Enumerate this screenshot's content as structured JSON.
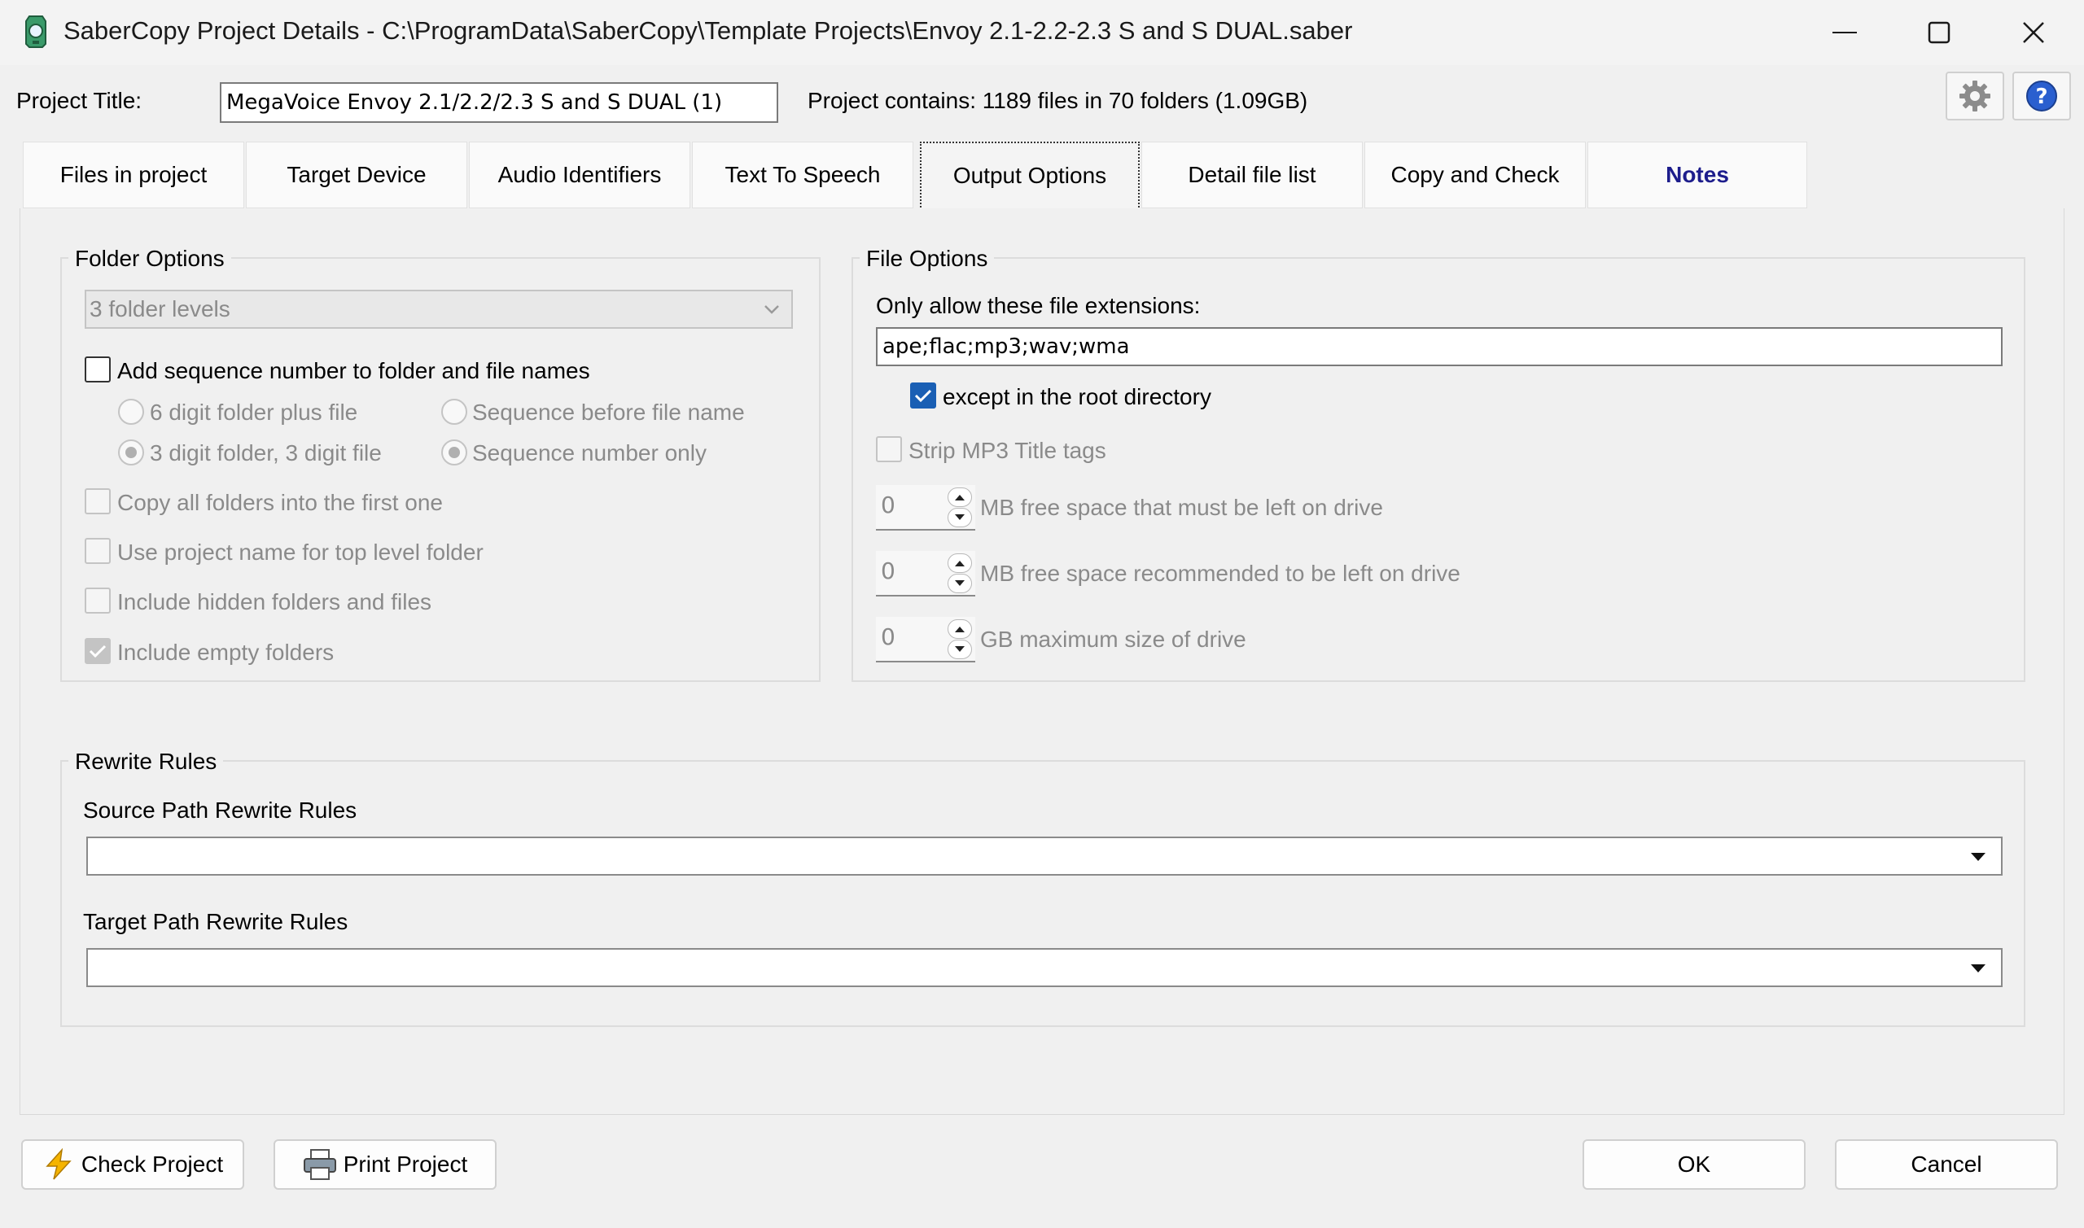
{
  "window": {
    "title": "SaberCopy Project Details - C:\\ProgramData\\SaberCopy\\Template Projects\\Envoy 2.1-2.2-2.3 S and S DUAL.saber"
  },
  "header": {
    "project_title_label": "Project Title:",
    "project_title_value": "MegaVoice Envoy 2.1/2.2/2.3 S and S DUAL (1)",
    "project_contains": "Project contains: 1189 files in 70 folders (1.09GB)"
  },
  "tabs": [
    {
      "label": "Files in project"
    },
    {
      "label": "Target Device"
    },
    {
      "label": "Audio Identifiers"
    },
    {
      "label": "Text To Speech"
    },
    {
      "label": "Output Options"
    },
    {
      "label": "Detail file list"
    },
    {
      "label": "Copy and Check"
    },
    {
      "label": "Notes"
    }
  ],
  "folder_options": {
    "legend": "Folder Options",
    "levels_value": "3 folder levels",
    "add_sequence_label": "Add sequence number to folder and file names",
    "radio_6digit": "6 digit folder plus file",
    "radio_seq_before": "Sequence before file name",
    "radio_3digit": "3 digit folder, 3 digit file",
    "radio_seq_only": "Sequence number only",
    "copy_all_label": "Copy all folders into the first one",
    "use_project_name_label": "Use project name for top level folder",
    "include_hidden_label": "Include hidden folders and files",
    "include_empty_label": "Include empty folders"
  },
  "file_options": {
    "legend": "File Options",
    "extensions_label": "Only allow these file extensions:",
    "extensions_value": "ape;flac;mp3;wav;wma",
    "except_root_label": "except in the root directory",
    "strip_mp3_label": "Strip MP3 Title tags",
    "free_space_required_value": "0",
    "free_space_required_label": "MB free space that must be left on drive",
    "free_space_recommended_value": "0",
    "free_space_recommended_label": "MB free space recommended to be left on drive",
    "max_size_value": "0",
    "max_size_label": "GB maximum size of drive"
  },
  "rewrite_rules": {
    "legend": "Rewrite Rules",
    "source_label": "Source Path Rewrite Rules",
    "target_label": "Target Path Rewrite Rules"
  },
  "buttons": {
    "check_project": "Check Project",
    "print_project": "Print Project",
    "ok": "OK",
    "cancel": "Cancel"
  },
  "colors": {
    "accent": "#1a5fb4",
    "notes_tab": "#1d1d8c",
    "disabled_text": "#8a8a8a"
  }
}
